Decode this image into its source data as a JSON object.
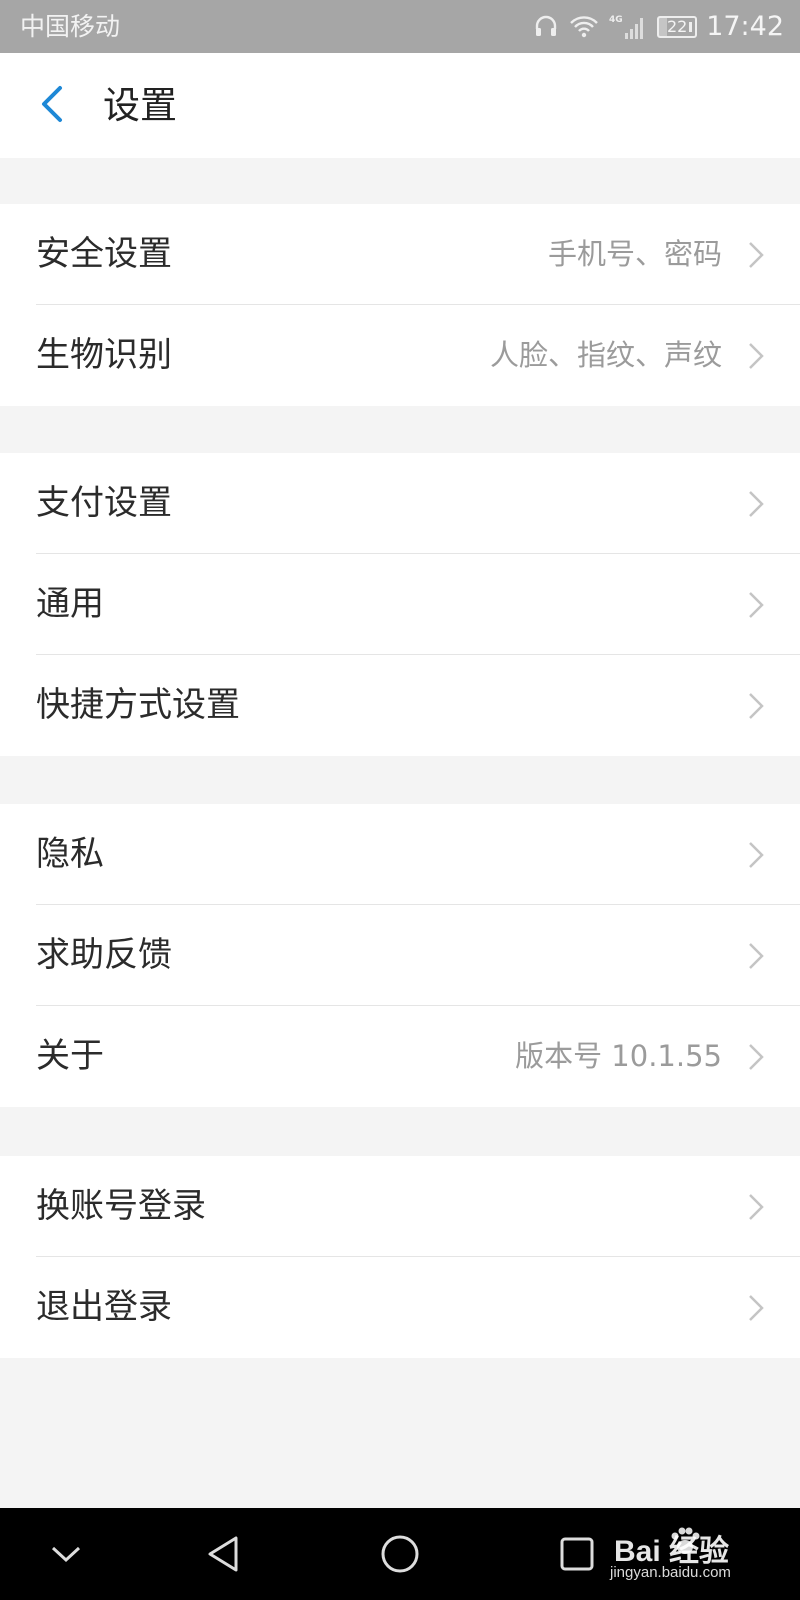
{
  "status_bar": {
    "carrier": "中国移动",
    "network": "4G",
    "battery_level": "22",
    "battery_fraction": 0.22,
    "time": "17:42",
    "icons": [
      "headset-icon",
      "wifi-icon",
      "signal-icon",
      "battery-icon"
    ]
  },
  "header": {
    "title": "设置",
    "back_icon": "chevron-left-icon",
    "accent_color": "#1e88d6"
  },
  "sections": [
    {
      "rows": [
        {
          "label": "安全设置",
          "value": "手机号、密码"
        },
        {
          "label": "生物识别",
          "value": "人脸、指纹、声纹"
        }
      ]
    },
    {
      "rows": [
        {
          "label": "支付设置",
          "value": ""
        },
        {
          "label": "通用",
          "value": ""
        },
        {
          "label": "快捷方式设置",
          "value": ""
        }
      ]
    },
    {
      "rows": [
        {
          "label": "隐私",
          "value": ""
        },
        {
          "label": "求助反馈",
          "value": ""
        },
        {
          "label": "关于",
          "value": "版本号 10.1.55"
        }
      ]
    },
    {
      "rows": [
        {
          "label": "换账号登录",
          "value": ""
        },
        {
          "label": "退出登录",
          "value": ""
        }
      ]
    }
  ],
  "nav_bar": {
    "buttons": [
      "chevron-down-icon",
      "back-triangle-icon",
      "home-circle-icon",
      "recents-square-icon"
    ]
  },
  "watermark": {
    "logo_text": "Bai 经验",
    "url": "jingyan.baidu.com"
  }
}
